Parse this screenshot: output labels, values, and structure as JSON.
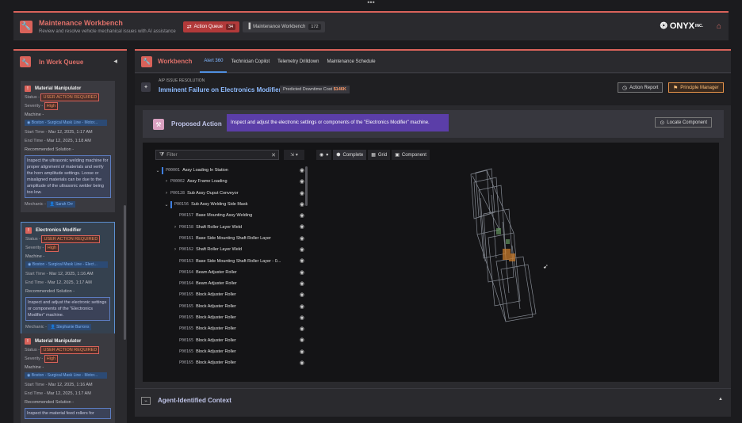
{
  "header": {
    "title": "Maintenance Workbench",
    "subtitle": "Review and resolve vehicle mechanical issues with AI assistance",
    "tabs": [
      {
        "label": "Action Queue",
        "count": "34"
      },
      {
        "label": "Maintenance Workbench",
        "count": "172"
      }
    ],
    "brand": "ONYX",
    "brand_suffix": "INC."
  },
  "queue": {
    "title": "In Work Queue",
    "cards": [
      {
        "title": "Material Manipulator",
        "status_label": "Status -",
        "status": "USER ACTION REQUIRED",
        "severity_label": "Severity -",
        "severity": "High",
        "machine_label": "Machine -",
        "machine": "Boston - Surgical Mask Line - Motor...",
        "start_label": "Start Time -",
        "start": "Mar 12, 2025, 1:17 AM",
        "end_label": "End Time -",
        "end": "Mar 12, 2025, 1:18 AM",
        "solution_label": "Recommended Solution -",
        "solution": "Inspect the ultrasonic welding machine for proper alignment of materials and verify the horn amplitude settings. Loose or misaligned materials can be due to the amplitude of the ultrasonic welder being too low.",
        "mechanic_label": "Mechanic -",
        "mechanic": "Sarah Orr"
      },
      {
        "title": "Electronics Modifier",
        "status_label": "Status -",
        "status": "USER ACTION REQUIRED",
        "severity_label": "Severity -",
        "severity": "High",
        "machine_label": "Machine -",
        "machine": "Boston - Surgical Mask Line - Elect...",
        "start_label": "Start Time -",
        "start": "Mar 12, 2025, 1:16 AM",
        "end_label": "End Time -",
        "end": "Mar 12, 2025, 1:17 AM",
        "solution_label": "Recommended Solution -",
        "solution": "Inspect and adjust the electronic settings or components of the \"Electronics Modifier\" machine.",
        "mechanic_label": "Mechanic -",
        "mechanic": "Stephanie Barrons"
      },
      {
        "title": "Material Manipulator",
        "status_label": "Status -",
        "status": "USER ACTION REQUIRED",
        "severity_label": "Severity -",
        "severity": "High",
        "machine_label": "Machine -",
        "machine": "Boston - Surgical Mask Line - Motor...",
        "start_label": "Start Time -",
        "start": "Mar 12, 2025, 1:16 AM",
        "end_label": "End Time -",
        "end": "Mar 12, 2025, 1:17 AM",
        "solution_label": "Recommended Solution -",
        "solution": "Inspect the material feed rollers for"
      }
    ]
  },
  "main": {
    "title": "Workbench",
    "tabs": [
      "Alert 360",
      "Technician Copilot",
      "Telemetry Drilldown",
      "Maintenance Schedule"
    ],
    "issue": {
      "label": "AIP ISSUE RESOLUTION",
      "title": "Imminent Failure on Electronics Modifier",
      "cost_label": "Predicted Downtime Cost",
      "cost": "$146K",
      "report_button": "Action Report",
      "manager_button": "Principle Manager"
    },
    "action": {
      "title": "Proposed Action",
      "text": "Inspect and adjust the electronic settings or components of the \"Electronics Modifier\" machine.",
      "locate_button": "Locate Component"
    },
    "viewer": {
      "filter_placeholder": "Filter",
      "view_modes": [
        "Complete",
        "Grid",
        "Component"
      ],
      "tree": [
        {
          "id": "P00001",
          "name": "Assy Loading In Station",
          "level": 0,
          "chevron": "v",
          "bar": true
        },
        {
          "id": "P00002",
          "name": "Assy Frame Loading",
          "level": 1,
          "chevron": ">"
        },
        {
          "id": "P00128",
          "name": "Sub Assy Ouput Conveyor",
          "level": 1,
          "chevron": ">"
        },
        {
          "id": "P00156",
          "name": "Sub Assy Welding Side Mask",
          "level": 1,
          "chevron": "v",
          "bar": true
        },
        {
          "id": "P00157",
          "name": "Base Mounting Assy Welding",
          "level": 2,
          "chevron": ""
        },
        {
          "id": "P00158",
          "name": "Shaft Roller Layer Weld",
          "level": 2,
          "chevron": ">"
        },
        {
          "id": "P00161",
          "name": "Base Side Mounting Shaft Roller Layer",
          "level": 2,
          "chevron": ""
        },
        {
          "id": "P00162",
          "name": "Shaft Roller Layer Weld",
          "level": 2,
          "chevron": ">"
        },
        {
          "id": "P00163",
          "name": "Base Side Mounting Shaft Roller Layer - 0...",
          "level": 2,
          "chevron": ""
        },
        {
          "id": "P00164",
          "name": "Beam Adjuster Roller",
          "level": 2,
          "chevron": ""
        },
        {
          "id": "P00164",
          "name": "Beam Adjuster Roller",
          "level": 2,
          "chevron": ""
        },
        {
          "id": "P00165",
          "name": "Block Adjuster Roller",
          "level": 2,
          "chevron": ""
        },
        {
          "id": "P00165",
          "name": "Block Adjuster Roller",
          "level": 2,
          "chevron": ""
        },
        {
          "id": "P00165",
          "name": "Block Adjuster Roller",
          "level": 2,
          "chevron": ""
        },
        {
          "id": "P00165",
          "name": "Block Adjuster Roller",
          "level": 2,
          "chevron": ""
        },
        {
          "id": "P00165",
          "name": "Block Adjuster Roller",
          "level": 2,
          "chevron": ""
        },
        {
          "id": "P00165",
          "name": "Block Adjuster Roller",
          "level": 2,
          "chevron": ""
        },
        {
          "id": "P00165",
          "name": "Block Adjuster Roller",
          "level": 2,
          "chevron": ""
        }
      ]
    },
    "context_title": "Agent-Identified Context"
  }
}
